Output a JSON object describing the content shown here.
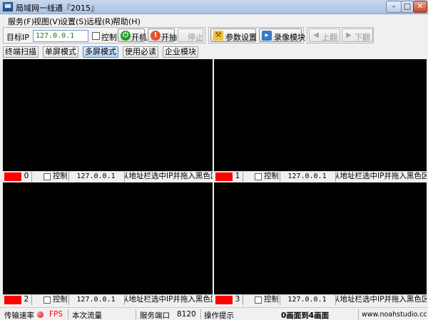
{
  "window": {
    "title": "局域网一线通『2015』",
    "minimize": "–",
    "maximize": "□",
    "close": "✕"
  },
  "menu": [
    "服务(F)",
    "视图(V)",
    "设置(S)",
    "远程(R)",
    "帮助(H)"
  ],
  "toolbar": {
    "target_ip_label": "目标IP",
    "target_ip_value": "127.0.0.1",
    "control_label": "控制",
    "power_label": "开机",
    "record_label": "开抽",
    "stop_label": "停止",
    "params_label": "参数设置",
    "recorder_label": "录像模块",
    "prev_label": "上翻",
    "next_label": "下翻"
  },
  "tabs": [
    "终端扫描",
    "单屏模式",
    "多屏模式",
    "使用必读",
    "企业模块"
  ],
  "active_tab": "多屏模式",
  "panes": [
    {
      "index": "0",
      "control_label": "控制",
      "ip": "127.0.0.1",
      "hint": "从地址栏选中IP并拖入黑色区域"
    },
    {
      "index": "1",
      "control_label": "控制",
      "ip": "127.0.0.1",
      "hint": "从地址栏选中IP并拖入黑色区域"
    },
    {
      "index": "2",
      "control_label": "控制",
      "ip": "127.0.0.1",
      "hint": "从地址栏选中IP并拖入黑色区域"
    },
    {
      "index": "3",
      "control_label": "控制",
      "ip": "127.0.0.1",
      "hint": "从地址栏选中IP并拖入黑色区域"
    }
  ],
  "status": {
    "speed_label": "传输速率",
    "fps_label": "FPS",
    "traffic_label": "本次流量",
    "port_label": "服务端口",
    "port_value": "8120",
    "tip_label": "操作提示",
    "tip_value": "0画面到4画面",
    "site": "www.noahstudio.cc"
  },
  "colors": {
    "fps_text": "#ff0000",
    "screen_bg": "#000000",
    "indicator": "#ff0000"
  }
}
